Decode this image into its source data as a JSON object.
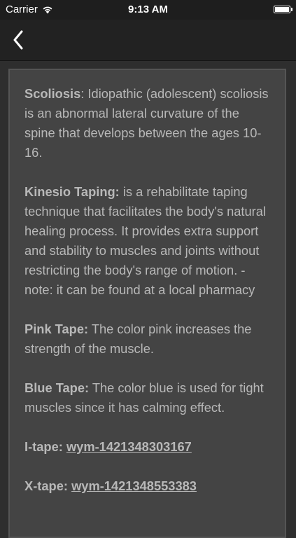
{
  "status_bar": {
    "carrier": "Carrier",
    "time": "9:13 AM",
    "icons": [
      "wifi-icon",
      "battery-icon"
    ]
  },
  "nav": {
    "back_icon": "chevron-left-icon"
  },
  "colors": {
    "background": "#2e2e2e",
    "card": "#444444",
    "card_border": "#555555",
    "text": "#b8b8b8",
    "navbar": "#222222"
  },
  "definitions": [
    {
      "term": "Scoliosis",
      "separator": ": ",
      "text": "Idiopathic (adolescent) scoliosis is an abnormal lateral curvature of the spine that develops between the ages 10-16."
    },
    {
      "term": "Kinesio Taping:",
      "separator": " ",
      "text": "is a rehabilitate taping technique that facilitates the body's natural healing process. It provides extra support and stability to muscles and joints without restricting the body's range of motion. - note: it can be found at a local pharmacy"
    },
    {
      "term": "Pink Tape:",
      "separator": " ",
      "text": "The color pink increases the strength of the muscle."
    },
    {
      "term": "Blue Tape:",
      "separator": " ",
      "text": "The color blue is used for tight muscles since it has calming effect."
    }
  ],
  "links": [
    {
      "label": "I-tape:",
      "separator": " ",
      "link_text": "wym-1421348303167"
    },
    {
      "label": "X-tape:",
      "separator": " ",
      "link_text": "wym-1421348553383"
    }
  ]
}
